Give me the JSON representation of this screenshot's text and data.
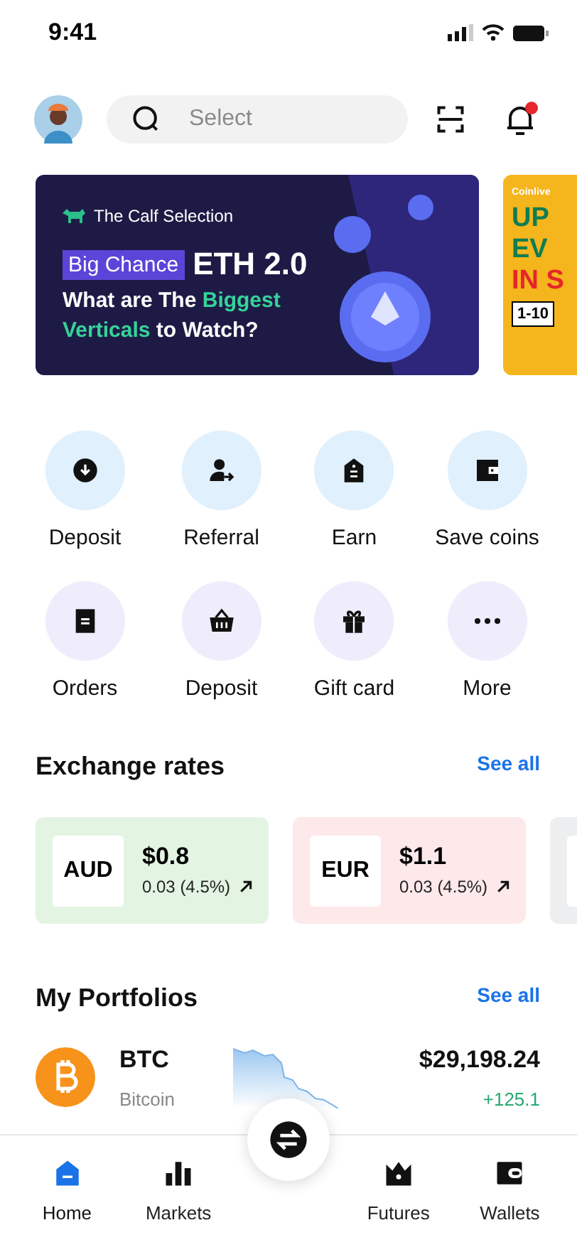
{
  "status_bar": {
    "time": "9:41"
  },
  "header": {
    "search": {
      "placeholder": "Select"
    },
    "notification_unread": true
  },
  "banners": [
    {
      "kind": "feature",
      "brand": "The Calf Selection",
      "tag": "Big Chance",
      "title": "ETH 2.0",
      "headline": [
        [
          {
            "text": "What are The ",
            "highlight": false
          },
          {
            "text": "Biggest",
            "highlight": true
          }
        ],
        [
          {
            "text": "Verticals",
            "highlight": true
          },
          {
            "text": " to Watch?",
            "highlight": false
          }
        ]
      ]
    },
    {
      "kind": "promo",
      "brand": "Coinlive",
      "lines": [
        "UP",
        "EV",
        "IN S"
      ],
      "badge": "1-10"
    }
  ],
  "quick_actions": [
    {
      "label": "Deposit",
      "color": "#e0f0fd"
    },
    {
      "label": "Referral",
      "color": "#e0f0fd"
    },
    {
      "label": "Earn",
      "color": "#e0f0fd"
    },
    {
      "label": "Save coins",
      "color": "#e0f0fd"
    },
    {
      "label": "Orders",
      "color": "#efedfc"
    },
    {
      "label": "Deposit",
      "color": "#efedfc"
    },
    {
      "label": "Gift card",
      "color": "#efedfc"
    },
    {
      "label": "More",
      "color": "#efedfc"
    }
  ],
  "exchange_rates": {
    "title": "Exchange rates",
    "link": "See all",
    "cards": [
      {
        "currency": "AUD",
        "price": "$0.8",
        "change": "0.03 (4.5%)",
        "color": "#e3f4e3"
      },
      {
        "currency": "EUR",
        "price": "$1.1",
        "change": "0.03 (4.5%)",
        "color": "#fde8ea"
      },
      {
        "color": "#eceeef"
      }
    ]
  },
  "portfolios": {
    "title": "My Portfolios",
    "link": "See all",
    "rows": [
      {
        "symbol": "BTC",
        "name": "Bitcoin",
        "price": "$29,198.24",
        "change": "+125.1"
      }
    ]
  },
  "bottom_nav": [
    {
      "label": "Home",
      "selected": true
    },
    {
      "label": "Markets",
      "selected": false
    },
    {
      "kind": "center",
      "selected": false
    },
    {
      "label": "Futures",
      "selected": false
    },
    {
      "label": "Wallets",
      "selected": false
    }
  ]
}
